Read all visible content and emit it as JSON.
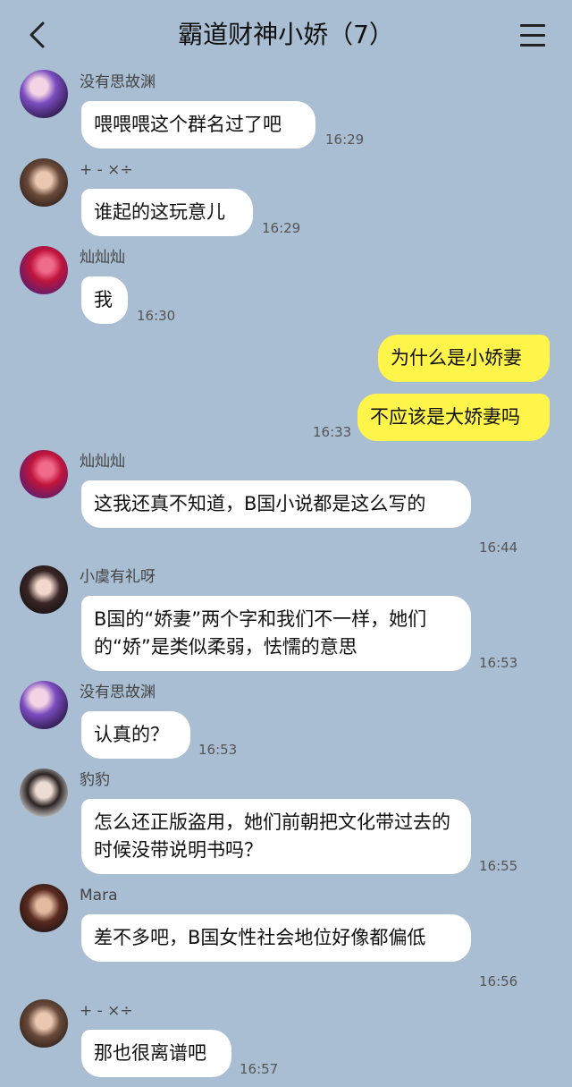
{
  "header": {
    "title": "霸道财神小娇（7）"
  },
  "messages": [
    {
      "sender": "没有思故渊",
      "text": "喂喂喂这个群名过了吧",
      "time": "16:29"
    },
    {
      "sender": "+ - ×÷",
      "text": "谁起的这玩意儿",
      "time": "16:29"
    },
    {
      "sender": "灿灿灿",
      "text": "我",
      "time": "16:30"
    },
    {
      "sender": "",
      "text": "为什么是小娇妻",
      "time": ""
    },
    {
      "sender": "",
      "text": "不应该是大娇妻吗",
      "time": "16:33"
    },
    {
      "sender": "灿灿灿",
      "text": "这我还真不知道，B国小说都是这么写的",
      "time": "16:44"
    },
    {
      "sender": "小虞有礼呀",
      "text": "B国的“娇妻”两个字和我们不一样，她们的“娇”是类似柔弱，怯懦的意思",
      "time": "16:53"
    },
    {
      "sender": "没有思故渊",
      "text": "认真的？",
      "time": "16:53"
    },
    {
      "sender": "豹豹",
      "text": "怎么还正版盗用，她们前朝把文化带过去的时候没带说明书吗？",
      "time": "16:55"
    },
    {
      "sender": "Mara",
      "text": "差不多吧，B国女性社会地位好像都偏低",
      "time": "16:56"
    },
    {
      "sender": "+ - ×÷",
      "text": "那也很离谱吧",
      "time": "16:57"
    }
  ]
}
